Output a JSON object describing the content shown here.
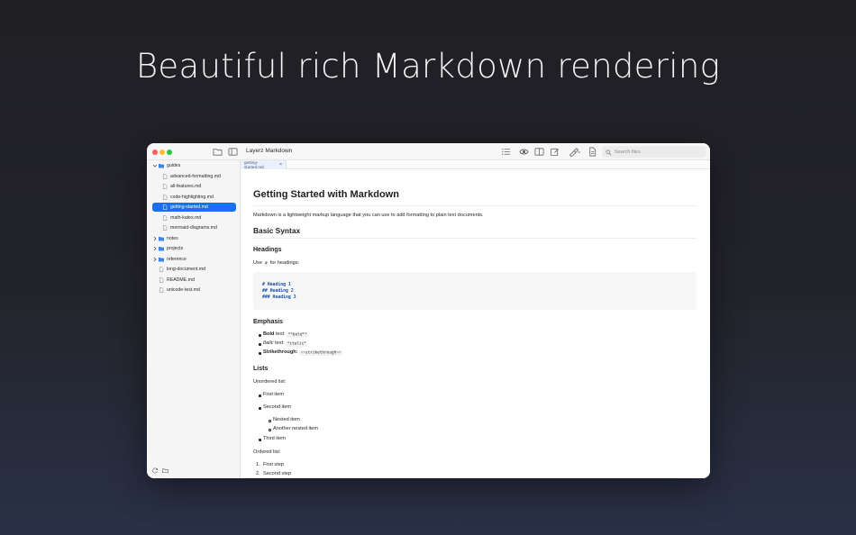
{
  "hero_title": "Beautiful rich Markdown rendering",
  "window": {
    "title": "Layerz Markdown",
    "search_placeholder": "Search files"
  },
  "toolbar_icons": [
    "folder-icon",
    "sidebar-toggle-icon",
    "list-icon",
    "eye-icon",
    "split-view-icon",
    "edit-icon",
    "brush-icon",
    "document-icon",
    "search-icon"
  ],
  "sidebar": {
    "tree": [
      {
        "label": "guides",
        "type": "folder",
        "expanded": true
      },
      {
        "label": "advanced-formatting.md",
        "type": "file"
      },
      {
        "label": "all-features.md",
        "type": "file"
      },
      {
        "label": "code-highlighting.md",
        "type": "file"
      },
      {
        "label": "getting-started.md",
        "type": "file",
        "selected": true
      },
      {
        "label": "math-katex.md",
        "type": "file"
      },
      {
        "label": "mermaid-diagrams.md",
        "type": "file"
      },
      {
        "label": "notes",
        "type": "folder",
        "expanded": false
      },
      {
        "label": "projects",
        "type": "folder",
        "expanded": false
      },
      {
        "label": "reference",
        "type": "folder",
        "expanded": false
      },
      {
        "label": "long-document.md",
        "type": "file"
      },
      {
        "label": "README.md",
        "type": "file"
      },
      {
        "label": "unicode-test.md",
        "type": "file"
      }
    ]
  },
  "tab": {
    "label": "getting-started.md",
    "close": "×"
  },
  "doc": {
    "h1": "Getting Started with Markdown",
    "intro": "Markdown is a lightweight markup language that you can use to add formatting to plain text documents.",
    "h2_basic": "Basic Syntax",
    "h3_headings": "Headings",
    "use_prefix": "Use",
    "use_code": "#",
    "use_suffix": "for headings:",
    "code_lines": [
      "# Heading 1",
      "## Heading 2",
      "### Heading 3"
    ],
    "h3_emphasis": "Emphasis",
    "emphasis": [
      {
        "label": "Bold",
        "suffix": "text:",
        "code": "**bold**"
      },
      {
        "label": "Italic",
        "suffix": "text:",
        "code": "*italic*"
      },
      {
        "label": "Strikethrough:",
        "suffix": "",
        "code": "~~strikethrough~~"
      }
    ],
    "h3_lists": "Lists",
    "unordered_label": "Unordered list:",
    "unordered": [
      "First item",
      "Second item",
      "Nested item",
      "Another nested item",
      "Third item"
    ],
    "ordered_label": "Ordered list:",
    "ordered": [
      "1.",
      "First step",
      "2.",
      "Second step"
    ]
  },
  "colors": {
    "accent": "#1a6ff2",
    "folder": "#3d86e8",
    "code_text": "#1b4fa8"
  }
}
